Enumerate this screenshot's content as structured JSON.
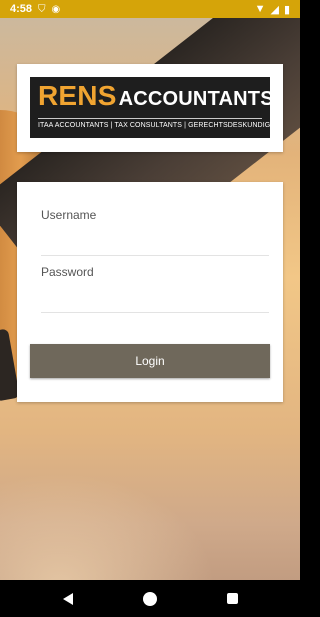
{
  "status_bar": {
    "time": "4:58",
    "icons": [
      "shield-icon",
      "circle-app-icon",
      "wifi-icon",
      "signal-icon",
      "battery-icon"
    ],
    "color": "#d5a409"
  },
  "logo": {
    "brand_primary": "RENS",
    "brand_secondary": "ACCOUNTANTS",
    "tagline": "ITAA ACCOUNTANTS | TAX CONSULTANTS | GERECHTSDESKUNDIGE",
    "brand_color": "#f0a431",
    "background": "#1e1e1e"
  },
  "login_form": {
    "username_label": "Username",
    "username_value": "",
    "password_label": "Password",
    "password_value": "",
    "login_label": "Login",
    "button_color": "#6f685b"
  },
  "nav_bar": {
    "icons": [
      "back-icon",
      "home-icon",
      "recents-icon"
    ]
  }
}
